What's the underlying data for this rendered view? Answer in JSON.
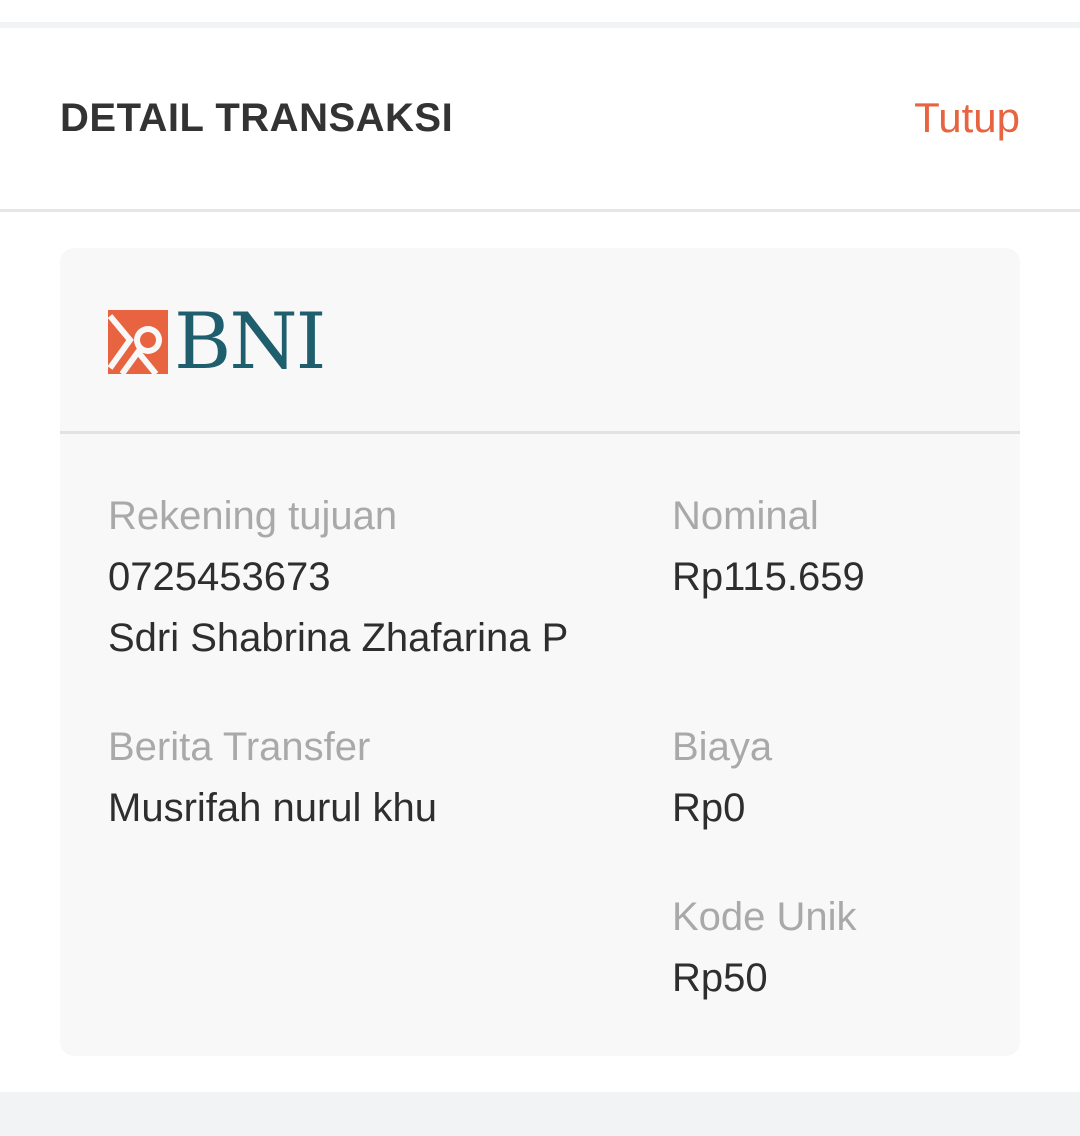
{
  "header": {
    "title": "DETAIL TRANSAKSI",
    "close_label": "Tutup"
  },
  "bank": {
    "logo_text": "BNI",
    "brand_colors": {
      "orange": "#e8633f",
      "teal": "#1f5e6d"
    }
  },
  "details": {
    "destination_account_label": "Rekening tujuan",
    "destination_account_number": "0725453673",
    "destination_account_name": "Sdri Shabrina Zhafarina P",
    "nominal_label": "Nominal",
    "nominal_value": "Rp115.659",
    "transfer_note_label": "Berita Transfer",
    "transfer_note_value": "Musrifah nurul khu",
    "fee_label": "Biaya",
    "fee_value": "Rp0",
    "unique_code_label": "Kode Unik",
    "unique_code_value": "Rp50"
  },
  "colors": {
    "accent": "#e8633f",
    "label": "#a9a9a9",
    "text": "#2e2e2e",
    "card_bg": "#f8f8f8"
  }
}
